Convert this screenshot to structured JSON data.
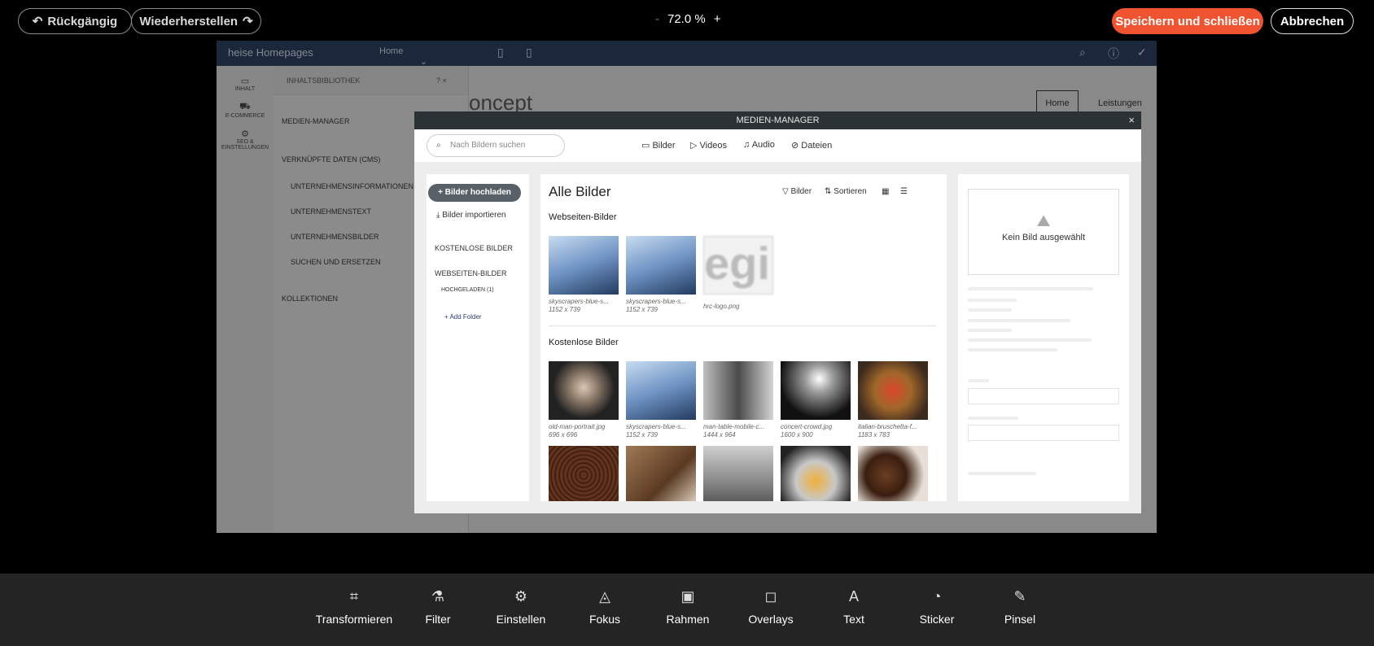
{
  "topbar": {
    "undo": "Rückgängig",
    "redo": "Wiederherstellen",
    "zoom_minus": "-",
    "zoom_value": "72.0 %",
    "zoom_plus": "+",
    "save": "Speichern und schließen",
    "cancel": "Abbrechen"
  },
  "editor": {
    "logo": "heise Homepages",
    "page_select": "Home",
    "concept": "oncept",
    "nav_home": "Home",
    "nav_leistungen": "Leistungen",
    "side": [
      "INHALT",
      "E-COMMERCE",
      "SEO & EINSTELLUNGEN"
    ],
    "library": {
      "title": "INHALTSBIBLIOTHEK",
      "items": [
        "MEDIEN-MANAGER",
        "VERKNÜPFTE DATEN (CMS)",
        "UNTERNEHMENSINFORMATIONEN",
        "UNTERNEHMENSTEXT",
        "UNTERNEHMENSBILDER",
        "SUCHEN UND ERSETZEN",
        "KOLLEKTIONEN"
      ]
    }
  },
  "media": {
    "title": "MEDIEN-MANAGER",
    "search_placeholder": "Nach Bildern suchen",
    "tabs": [
      "Bilder",
      "Videos",
      "Audio",
      "Dateien"
    ],
    "upload": "Bilder hochladen",
    "import": "Bilder importieren",
    "free": "KOSTENLOSE BILDER",
    "web": "WEBSEITEN-BILDER",
    "uploaded": "HOCHGELADEN (1)",
    "add_folder": "Add Folder",
    "all_images": "Alle Bilder",
    "filter": "Bilder",
    "sort": "Sortieren",
    "sec_web": "Webseiten-Bilder",
    "sec_free": "Kostenlose Bilder",
    "web_images": [
      {
        "name": "skyscrapers-blue-s...",
        "size": "1152 x 739"
      },
      {
        "name": "skyscrapers-blue-s...",
        "size": "1152 x 739"
      },
      {
        "name": "hrc-logo.png",
        "size": ""
      }
    ],
    "free_images": [
      {
        "name": "old-man-portrait.jpg",
        "size": "696 x 696"
      },
      {
        "name": "skyscrapers-blue-s...",
        "size": "1152 x 739"
      },
      {
        "name": "man-table-mobile-c...",
        "size": "1444 x 964"
      },
      {
        "name": "concert-crowd.jpg",
        "size": "1600 x 900"
      },
      {
        "name": "italian-bruschetta-f...",
        "size": "1183 x 783"
      }
    ],
    "no_image": "Kein Bild ausgewählt"
  },
  "tools": [
    "Transformieren",
    "Filter",
    "Einstellen",
    "Fokus",
    "Rahmen",
    "Overlays",
    "Text",
    "Sticker",
    "Pinsel"
  ]
}
